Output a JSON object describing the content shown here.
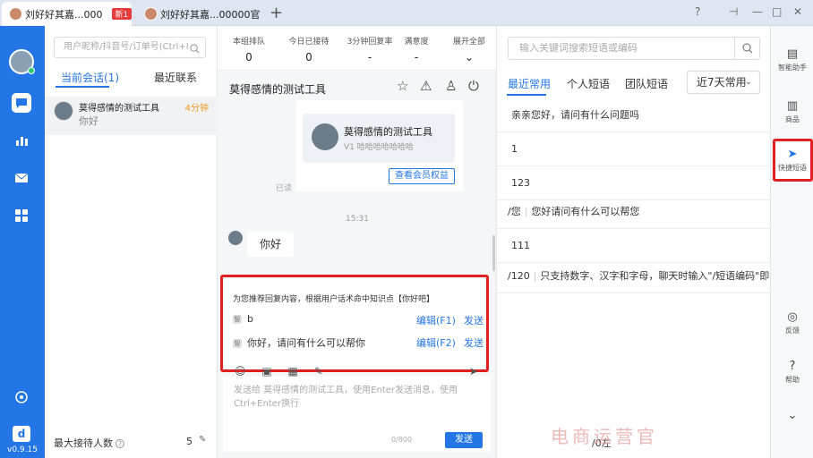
{
  "titlebar": {
    "tab1": {
      "label": "刘好好其嘉...000",
      "badge": "新1"
    },
    "tab2": {
      "label": "刘好好其嘉...00000官"
    },
    "plus": "+",
    "controls": [
      "?",
      "⊣",
      "—",
      "□",
      "✕"
    ]
  },
  "sidebar": {
    "version": "v0.9.15",
    "logo": "d"
  },
  "convlist": {
    "search_placeholder": "用户昵称/抖音号/订单号(Ctrl+I",
    "tabs": [
      {
        "label": "当前会话(1)",
        "active": true
      },
      {
        "label": "最近联系",
        "active": false
      }
    ],
    "items": [
      {
        "name": "莫得感情的测试工具",
        "time": "4分钟",
        "msg": "你好"
      }
    ],
    "max_recv_label": "最大接待人数",
    "max_recv_value": "5"
  },
  "stats": [
    {
      "label": "本组排队",
      "value": "0"
    },
    {
      "label": "今日已接待",
      "value": "0"
    },
    {
      "label": "3分钟回复率",
      "value": "-"
    },
    {
      "label": "满意度",
      "value": "-"
    },
    {
      "label": "展开全部",
      "value": "⌄"
    }
  ],
  "chat": {
    "title": "莫得感情的测试工具",
    "card_name": "莫得感情的测试工具",
    "card_sub": "V1 哈哈哈哈哈哈哈",
    "card_btn": "查看会员权益",
    "card_read": "已读",
    "timestamp": "15:31",
    "message": "你好",
    "suggest_title": "为您推荐回复内容，根据用户话术命中知识点【你好吧】",
    "suggestions": [
      {
        "tag": "智",
        "text": "b",
        "edit": "编辑(F1)",
        "send": "发送"
      },
      {
        "tag": "智",
        "text": "你好，请问有什么可以帮你",
        "edit": "编辑(F2)",
        "send": "发送"
      }
    ],
    "input_placeholder": "发送给 莫得感情的测试工具，使用Enter发送消息，使用Ctrl+Enter换行",
    "counter": "0/800",
    "send": "发送"
  },
  "phrase": {
    "search_placeholder": "输入关键词搜索短语或编码",
    "tabs": [
      {
        "label": "最近常用",
        "active": true
      },
      {
        "label": "个人短语",
        "active": false
      },
      {
        "label": "团队短语",
        "active": false
      }
    ],
    "select": "近7天常用",
    "rows": [
      {
        "code": "",
        "text": "亲亲您好，请问有什么问题吗"
      },
      {
        "code": "",
        "text": "1"
      },
      {
        "code": "",
        "text": "123"
      },
      {
        "code": "/您",
        "text": "您好请问有什么可以帮您"
      },
      {
        "code": "",
        "text": "111"
      },
      {
        "code": "/120",
        "text": "只支持数字、汉字和字母，聊天时输入\"/短语编码\"即..."
      }
    ],
    "footer": "/0左"
  },
  "rightbar": {
    "items": [
      {
        "label": "智能助手",
        "icon": "assistant-icon"
      },
      {
        "label": "商品",
        "icon": "goods-icon"
      },
      {
        "label": "快捷短语",
        "icon": "send-icon"
      },
      {
        "label": "反馈",
        "icon": "feedback-icon"
      },
      {
        "label": "帮助",
        "icon": "help-icon"
      }
    ]
  },
  "watermark": "电商运营官",
  "colors": {
    "accent": "#2476e6",
    "highlight": "#e02020",
    "time": "#f29a1f"
  }
}
